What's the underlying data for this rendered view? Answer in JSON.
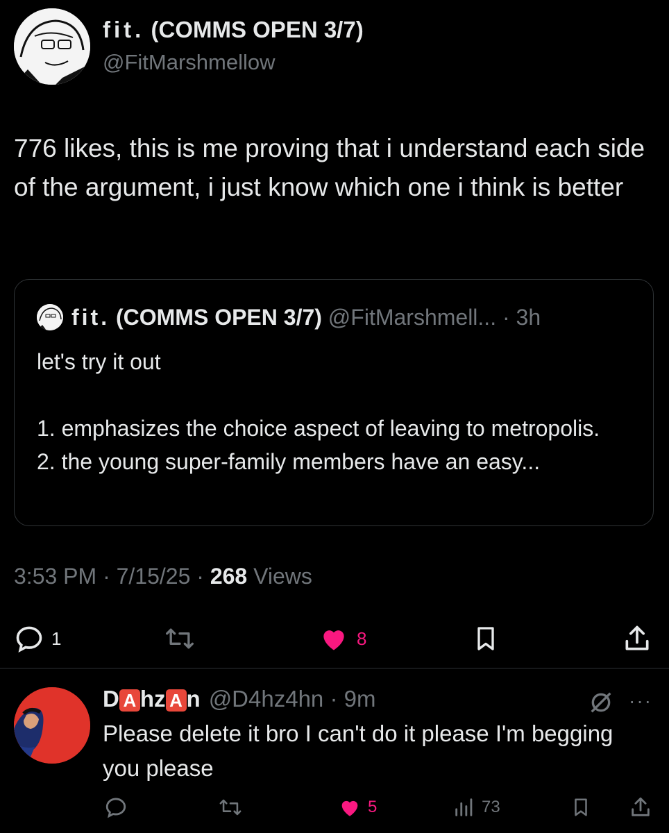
{
  "tweet": {
    "author": {
      "name_short": "fit.",
      "name_rest": " (COMMS OPEN 3/7)",
      "handle": "@FitMarshmellow"
    },
    "text": "776 likes, this is me proving that i understand each side of the argument, i just know which one i think is better",
    "quoted": {
      "name_short": "fit.",
      "name_rest": " (COMMS OPEN 3/7)",
      "handle_time": "@FitMarshmell... · 3h",
      "text": "let's try it out\n\n1. emphasizes the choice aspect of leaving to metropolis.\n2. the young super-family members have an easy..."
    },
    "meta": {
      "time_date": "3:53 PM · 7/15/25 · ",
      "views_count": "268",
      "views_label": " Views"
    },
    "actions": {
      "replies": "1",
      "likes": "8"
    }
  },
  "reply": {
    "name_parts": {
      "d": "D",
      "a1": "A",
      "hz": "hz",
      "a2": "A",
      "n": "n"
    },
    "handle_time": "@D4hz4hn · 9m",
    "more": "···",
    "text": "Please delete it bro I can't do it please I'm begging you please",
    "actions": {
      "likes": "5",
      "views": "73"
    }
  },
  "colors": {
    "like_active": "#f91880",
    "muted": "#71767b",
    "text": "#e7e9ea",
    "avatar_red": "#e0332a"
  }
}
